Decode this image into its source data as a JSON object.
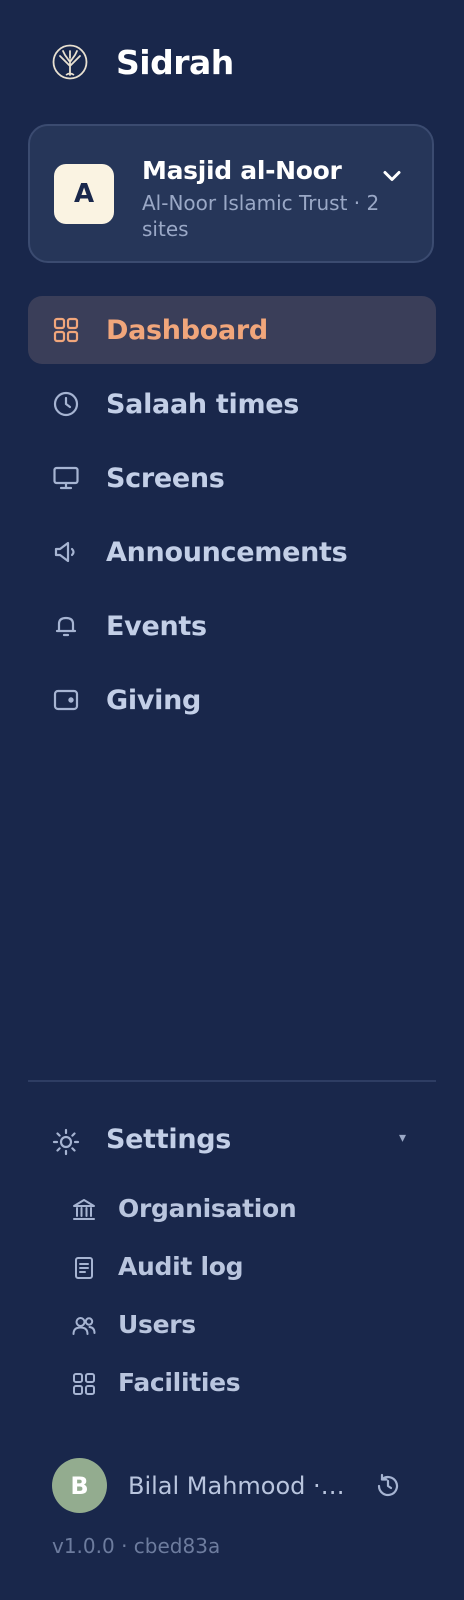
{
  "brand": {
    "name": "Sidrah",
    "logo": "tree-logo"
  },
  "org": {
    "avatar_letter": "A",
    "name": "Masjid al-Noor",
    "subtitle": "Al-Noor Islamic Trust · 2 sites",
    "dropdown_icon": "chevron-down-icon"
  },
  "nav": {
    "active": "Dashboard",
    "items": [
      {
        "label": "Dashboard",
        "icon": "grid-icon"
      },
      {
        "label": "Salaah times",
        "icon": "clock-icon"
      },
      {
        "label": "Screens",
        "icon": "monitor-icon"
      },
      {
        "label": "Announcements",
        "icon": "megaphone-icon"
      },
      {
        "label": "Events",
        "icon": "bell-icon"
      },
      {
        "label": "Giving",
        "icon": "wallet-icon"
      }
    ]
  },
  "settings": {
    "label": "Settings",
    "icon": "sun-icon",
    "caret": "▾",
    "items": [
      {
        "label": "Organisation",
        "icon": "building-icon"
      },
      {
        "label": "Audit log",
        "icon": "document-icon"
      },
      {
        "label": "Users",
        "icon": "users-icon"
      },
      {
        "label": "Facilities",
        "icon": "grid-icon"
      }
    ]
  },
  "user": {
    "avatar_letter": "B",
    "display": "Bilal Mahmood · admin",
    "action_icon": "refresh-icon"
  },
  "version": "v1.0.0 · cbed83a",
  "colors": {
    "background": "#19274b",
    "accent": "#f1a67b",
    "active_bg": "#3a3e59",
    "card_bg": "#263659",
    "user_avatar": "#93ac8f"
  }
}
